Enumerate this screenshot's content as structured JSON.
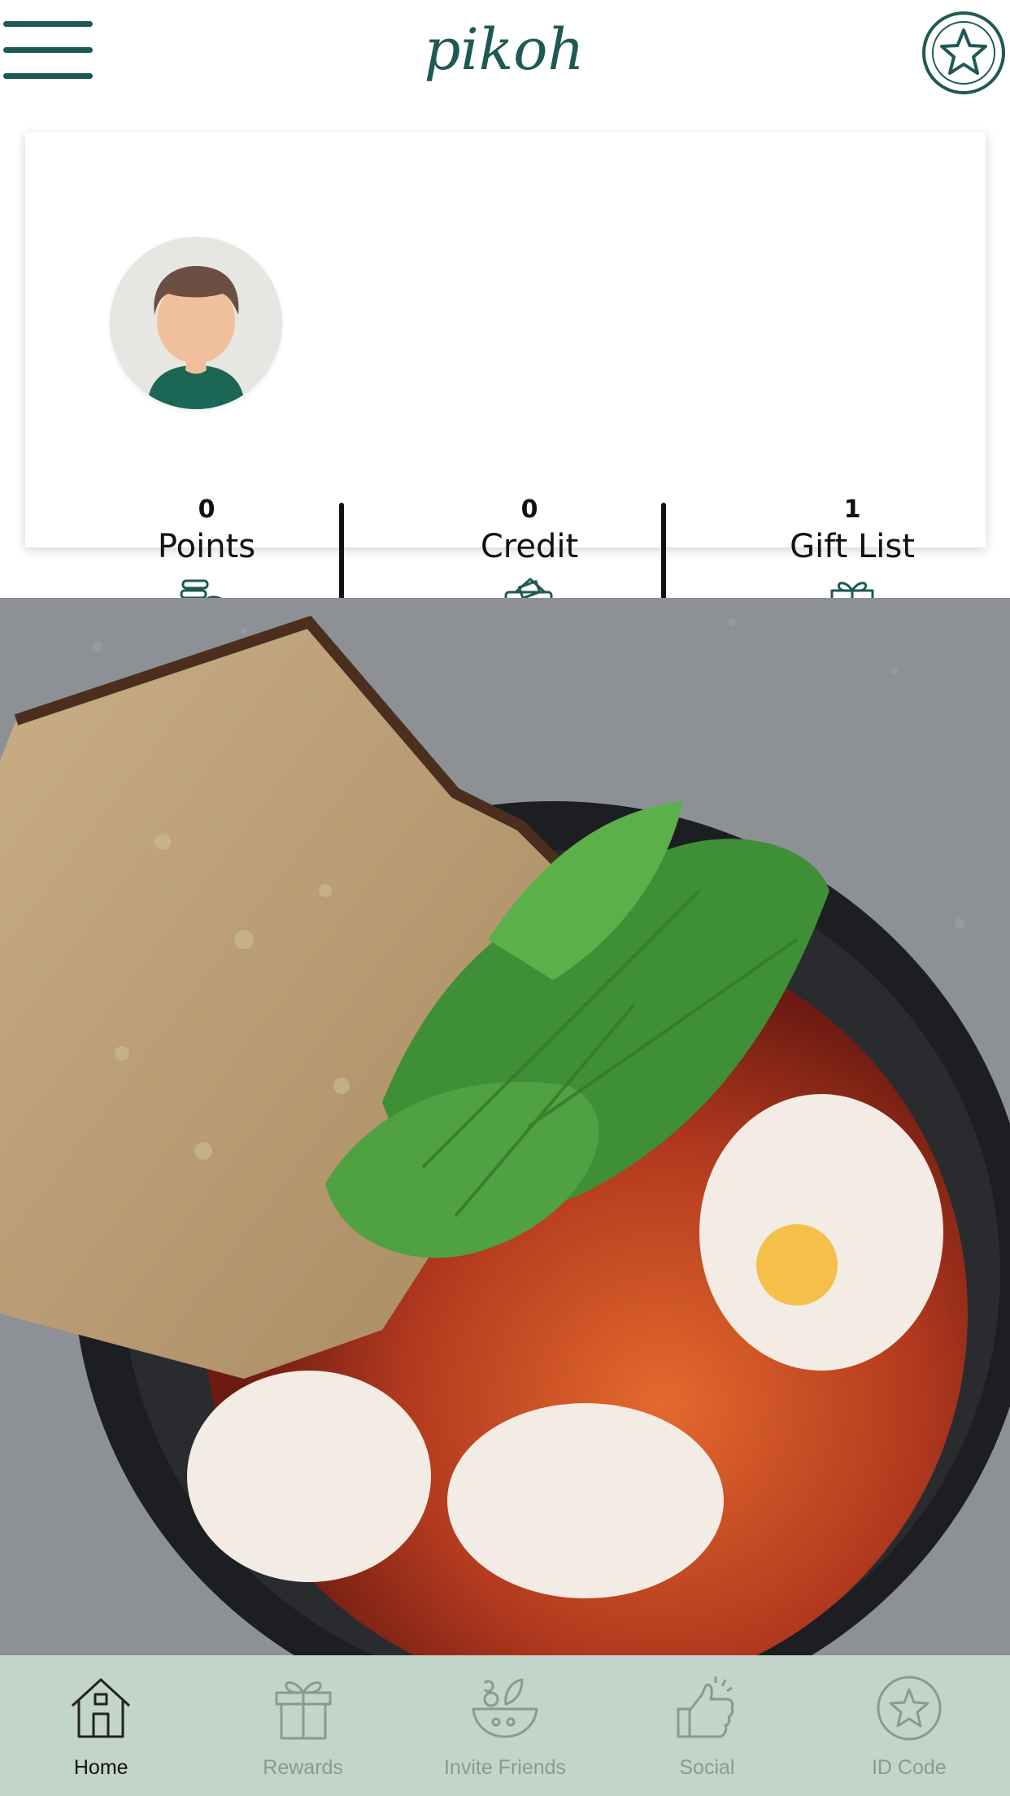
{
  "app": {
    "logo_text": "pikoh"
  },
  "header": {
    "menu_icon": "hamburger-icon",
    "star_icon": "star-icon"
  },
  "profile": {
    "avatar_icon": "user-avatar-icon",
    "stats": [
      {
        "value": "0",
        "label": "Points",
        "icon": "coins-icon"
      },
      {
        "value": "0",
        "label": "Credit",
        "icon": "wallet-icon"
      },
      {
        "value": "1",
        "label": "Gift List",
        "icon": "gift-icon"
      }
    ]
  },
  "hero": {
    "image": "shakshuka-food-photo"
  },
  "tabbar": {
    "tabs": [
      {
        "label": "Home",
        "icon": "home-icon",
        "active": true
      },
      {
        "label": "Rewards",
        "icon": "gift-icon",
        "active": false
      },
      {
        "label": "Invite Friends",
        "icon": "salad-bowl-icon",
        "active": false
      },
      {
        "label": "Social",
        "icon": "thumbs-up-icon",
        "active": false
      },
      {
        "label": "ID Code",
        "icon": "star-badge-icon",
        "active": false
      }
    ]
  },
  "colors": {
    "brand": "#1e5a52",
    "tabbar_bg": "#c3d4ca",
    "tab_inactive": "#8a9a92",
    "tab_active": "#111111"
  }
}
